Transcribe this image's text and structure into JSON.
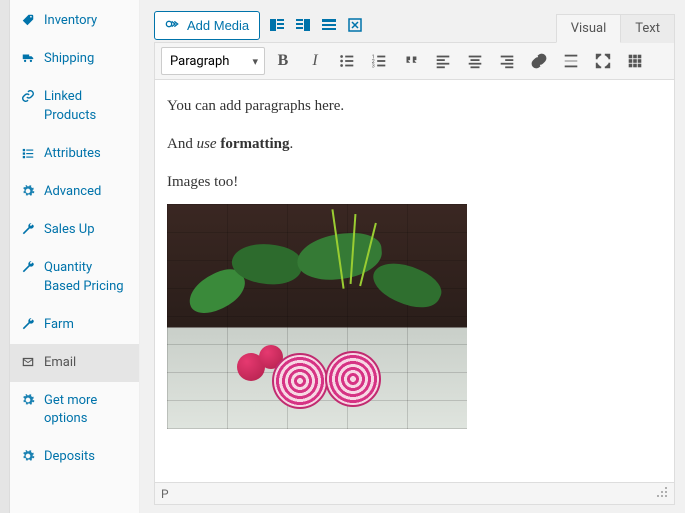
{
  "sidebar": {
    "items": [
      {
        "label": "Inventory",
        "icon": "tag-icon"
      },
      {
        "label": "Shipping",
        "icon": "truck-icon"
      },
      {
        "label": "Linked Products",
        "icon": "link-icon"
      },
      {
        "label": "Attributes",
        "icon": "list-icon"
      },
      {
        "label": "Advanced",
        "icon": "gear-icon"
      },
      {
        "label": "Sales Up",
        "icon": "wrench-icon"
      },
      {
        "label": "Quantity Based Pricing",
        "icon": "wrench-icon"
      },
      {
        "label": "Farm",
        "icon": "wrench-icon"
      },
      {
        "label": "Email",
        "icon": "mail-icon",
        "active": true
      },
      {
        "label": "Get more options",
        "icon": "gear-icon"
      },
      {
        "label": "Deposits",
        "icon": "gear-icon"
      }
    ]
  },
  "topbar": {
    "add_media_label": "Add Media"
  },
  "tabs": {
    "visual": "Visual",
    "text": "Text",
    "active": "visual"
  },
  "toolbar": {
    "format_selected": "Paragraph"
  },
  "content": {
    "p1": "You can add paragraphs here.",
    "p2_a": "And ",
    "p2_b": "use",
    "p2_c": " ",
    "p2_d": "formatting",
    "p2_e": ".",
    "p3": "Images too!"
  },
  "statusbar": {
    "path": "P"
  }
}
